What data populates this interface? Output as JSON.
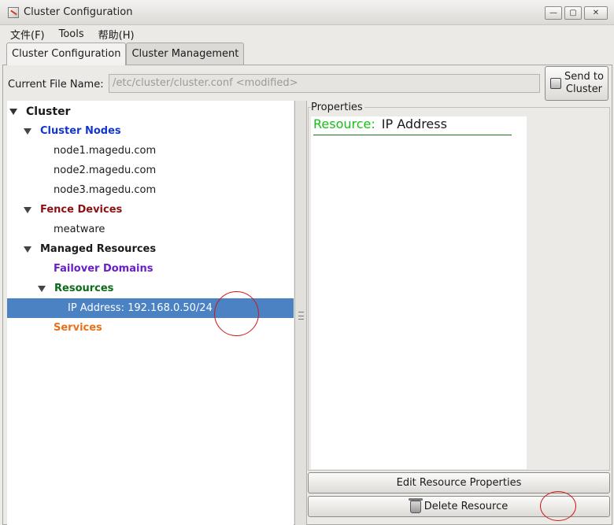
{
  "window": {
    "title": "Cluster Configuration",
    "controls": {
      "minimize": "—",
      "maximize": "▢",
      "close": "✕"
    }
  },
  "menu": [
    {
      "label": "文件(F)"
    },
    {
      "label": "Tools"
    },
    {
      "label": "帮助(H)"
    }
  ],
  "tabs": [
    {
      "label": "Cluster Configuration",
      "active": true
    },
    {
      "label": "Cluster Management",
      "active": false
    }
  ],
  "file": {
    "label": "Current File Name:",
    "value": "/etc/cluster/cluster.conf <modified>"
  },
  "send_button": {
    "label": "Send to\nCluster",
    "icon": "send-icon"
  },
  "tree": {
    "root": "Cluster",
    "nodes_header": "Cluster Nodes",
    "nodes": [
      "node1.magedu.com",
      "node2.magedu.com",
      "node3.magedu.com"
    ],
    "fence_header": "Fence Devices",
    "fence_items": [
      "meatware"
    ],
    "managed_header": "Managed Resources",
    "failover": "Failover Domains",
    "resources_header": "Resources",
    "selected_item": "IP Address:  192.168.0.50/24",
    "services": "Services"
  },
  "properties": {
    "label": "Properties",
    "key": "Resource:",
    "value": "IP Address"
  },
  "buttons": {
    "edit": "Edit Resource Properties",
    "delete": "Delete Resource"
  },
  "colors": {
    "selection": "#4a82c3",
    "nodes": "#1537c9",
    "fence": "#8b1212",
    "failover": "#6a1fc6",
    "resources": "#0a6a1a",
    "services": "#e8711b",
    "resource_key": "#15c015",
    "annotation": "#d01818"
  }
}
